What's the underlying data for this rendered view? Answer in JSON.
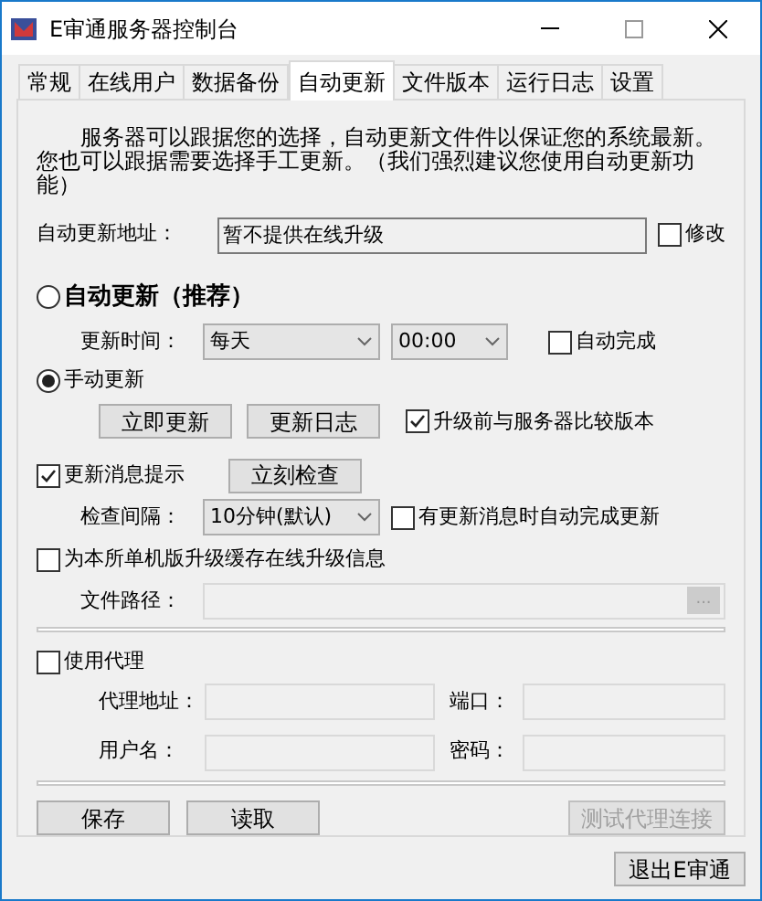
{
  "window": {
    "title": "E审通服务器控制台"
  },
  "tabs": [
    {
      "label": "常规",
      "selected": false
    },
    {
      "label": "在线用户",
      "selected": false
    },
    {
      "label": "数据备份",
      "selected": false
    },
    {
      "label": "自动更新",
      "selected": true
    },
    {
      "label": "文件版本",
      "selected": false
    },
    {
      "label": "运行日志",
      "selected": false
    },
    {
      "label": "设置",
      "selected": false
    }
  ],
  "intro": "服务器可以跟据您的选择，自动更新文件件以保证您的系统最新。您也可以跟据需要选择手工更新。（我们强烈建议您使用自动更新功能）",
  "update_url": {
    "label": "自动更新地址：",
    "value": "暂不提供在线升级",
    "modify": {
      "label": "修改",
      "checked": false
    }
  },
  "auto_update": {
    "label": "自动更新（推荐）",
    "selected": false,
    "time_label": "更新时间：",
    "frequency": "每天",
    "time": "00:00",
    "auto_complete": {
      "label": "自动完成",
      "checked": false
    }
  },
  "manual_update": {
    "label": "手动更新",
    "selected": true,
    "buttons": [
      "立即更新",
      "更新日志"
    ],
    "compare": {
      "label": "升级前与服务器比较版本",
      "checked": true
    }
  },
  "notify": {
    "label": "更新消息提示",
    "checked": true,
    "check_button": "立刻检查",
    "interval_label": "检查间隔：",
    "interval": "10分钟(默认)",
    "auto_finish": {
      "label": "有更新消息时自动完成更新",
      "checked": false
    }
  },
  "cache": {
    "label": "为本所单机版升级缓存在线升级信息",
    "checked": false,
    "path_label": "文件路径：",
    "browse": "..."
  },
  "proxy": {
    "label": "使用代理",
    "checked": false,
    "address_label": "代理地址：",
    "port_label": "端口：",
    "user_label": "用户名：",
    "password_label": "密码："
  },
  "buttons": [
    {
      "label": "保存",
      "disabled": false
    },
    {
      "label": "读取",
      "disabled": false
    },
    {
      "label": "测试代理连接",
      "disabled": true
    }
  ],
  "exit_button": "退出E审通"
}
